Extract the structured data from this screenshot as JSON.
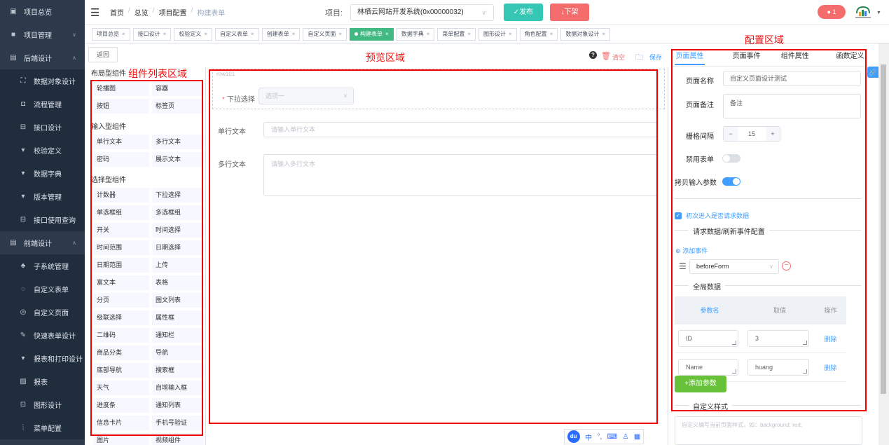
{
  "sidebar": {
    "items": [
      {
        "label": "项目总览",
        "icon": "desktop-icon",
        "level": "top"
      },
      {
        "label": "项目管理",
        "icon": "box-icon",
        "level": "top",
        "arrow": "chevron-down-icon"
      },
      {
        "label": "后端设计",
        "icon": "server-icon",
        "level": "top",
        "arrow": "chevron-up-icon"
      },
      {
        "label": "数据对象设计",
        "icon": "data-icon",
        "level": "sub"
      },
      {
        "label": "流程管理",
        "icon": "flow-icon",
        "level": "sub"
      },
      {
        "label": "接口设计",
        "icon": "api-icon",
        "level": "sub"
      },
      {
        "label": "校验定义",
        "icon": "cup-icon",
        "level": "sub"
      },
      {
        "label": "数据字典",
        "icon": "cup-icon",
        "level": "sub"
      },
      {
        "label": "版本管理",
        "icon": "cup-icon",
        "level": "sub"
      },
      {
        "label": "接口使用查询",
        "icon": "api-icon",
        "level": "sub"
      },
      {
        "label": "前端设计",
        "icon": "server-icon",
        "level": "top",
        "arrow": "chevron-up-icon"
      },
      {
        "label": "子系统管理",
        "icon": "tree-icon",
        "level": "sub"
      },
      {
        "label": "自定义表单",
        "icon": "form-icon",
        "level": "sub"
      },
      {
        "label": "自定义页面",
        "icon": "page-icon",
        "level": "sub"
      },
      {
        "label": "快速表单设计",
        "icon": "edit-icon",
        "level": "sub"
      },
      {
        "label": "报表和打印设计",
        "icon": "cup-icon",
        "level": "sub"
      },
      {
        "label": "报表",
        "icon": "report-icon",
        "level": "sub"
      },
      {
        "label": "图形设计",
        "icon": "chart-icon",
        "level": "sub"
      },
      {
        "label": "菜单配置",
        "icon": "menu-icon",
        "level": "sub"
      }
    ]
  },
  "header": {
    "breadcrumb": [
      "首页",
      "总览",
      "项目配置",
      "构建表单"
    ],
    "project_label": "项目:",
    "project_value": "林栖云网站开发系统(0x00000032)",
    "publish_label": "发布",
    "offline_label": "下架",
    "notif_count": "1"
  },
  "tags": [
    {
      "label": "项目总览",
      "active": false
    },
    {
      "label": "接口设计",
      "active": false
    },
    {
      "label": "校验定义",
      "active": false
    },
    {
      "label": "自定义表单",
      "active": false
    },
    {
      "label": "创建表单",
      "active": false
    },
    {
      "label": "自定义页面",
      "active": false
    },
    {
      "label": "构建表单",
      "active": true
    },
    {
      "label": "数据字典",
      "active": false
    },
    {
      "label": "菜单配置",
      "active": false
    },
    {
      "label": "图形设计",
      "active": false
    },
    {
      "label": "角色配置",
      "active": false
    },
    {
      "label": "数据对象设计",
      "active": false
    }
  ],
  "main": {
    "back_label": "返回",
    "annotations": {
      "components_area": "组件列表区域",
      "preview_area": "预览区域",
      "config_area": "配置区域"
    },
    "component_groups": [
      {
        "title": "布局型组件",
        "items": [
          "轮播图",
          "容器",
          "按钮",
          "标签页"
        ]
      },
      {
        "title": "输入型组件",
        "items": [
          "单行文本",
          "多行文本",
          "密码",
          "展示文本"
        ]
      },
      {
        "title": "选择型组件",
        "items": [
          "计数器",
          "下拉选择",
          "单选框组",
          "多选框组",
          "开关",
          "时间选择",
          "时间范围",
          "日期选择",
          "日期范围",
          "上传",
          "富文本",
          "表格",
          "分页",
          "图文列表",
          "级联选择",
          "属性框",
          "二维码",
          "通知栏",
          "商品分类",
          "导航",
          "底部导航",
          "搜索框",
          "天气",
          "自增输入框",
          "进度条",
          "通知列表",
          "信息卡片",
          "手机号验证",
          "图片",
          "视频组件"
        ]
      }
    ],
    "toolbar": {
      "clear_label": "清空",
      "save_label": "保存"
    },
    "preview": {
      "row_tag": "row101",
      "select_label": "下拉选择",
      "select_placeholder": "选项一",
      "single_text_label": "单行文本",
      "single_text_placeholder": "请输入单行文本",
      "multi_text_label": "多行文本",
      "multi_text_placeholder": "请输入多行文本"
    }
  },
  "config": {
    "tabs": [
      "页面属性",
      "页面事件",
      "组件属性",
      "函数定义"
    ],
    "page_name_label": "页面名称",
    "page_name_value": "自定义页面设计测试",
    "page_remark_label": "页面备注",
    "page_remark_value": "备注",
    "grid_gap_label": "栅格间隔",
    "grid_gap_value": "15",
    "disable_form_label": "禁用表单",
    "copy_params_label": "拷贝输入参数",
    "first_request_label": "初次进入是否请求数据",
    "request_section_title": "请求数据/刷新事件配置",
    "add_event_label": "添加事件",
    "event_value": "beforeForm",
    "global_data_title": "全局数据",
    "table_headers": [
      "参数名",
      "取值",
      "操作"
    ],
    "table_rows": [
      {
        "name": "ID",
        "value": "3",
        "action": "删除"
      },
      {
        "name": "Name",
        "value": "huang",
        "action": "删除"
      }
    ],
    "add_param_label": "+添加参数",
    "custom_style_title": "自定义样式",
    "custom_style_placeholder": "自定义编写当前页面样式，如：background: red;"
  },
  "ime": {
    "du": "du",
    "zh": "中"
  }
}
